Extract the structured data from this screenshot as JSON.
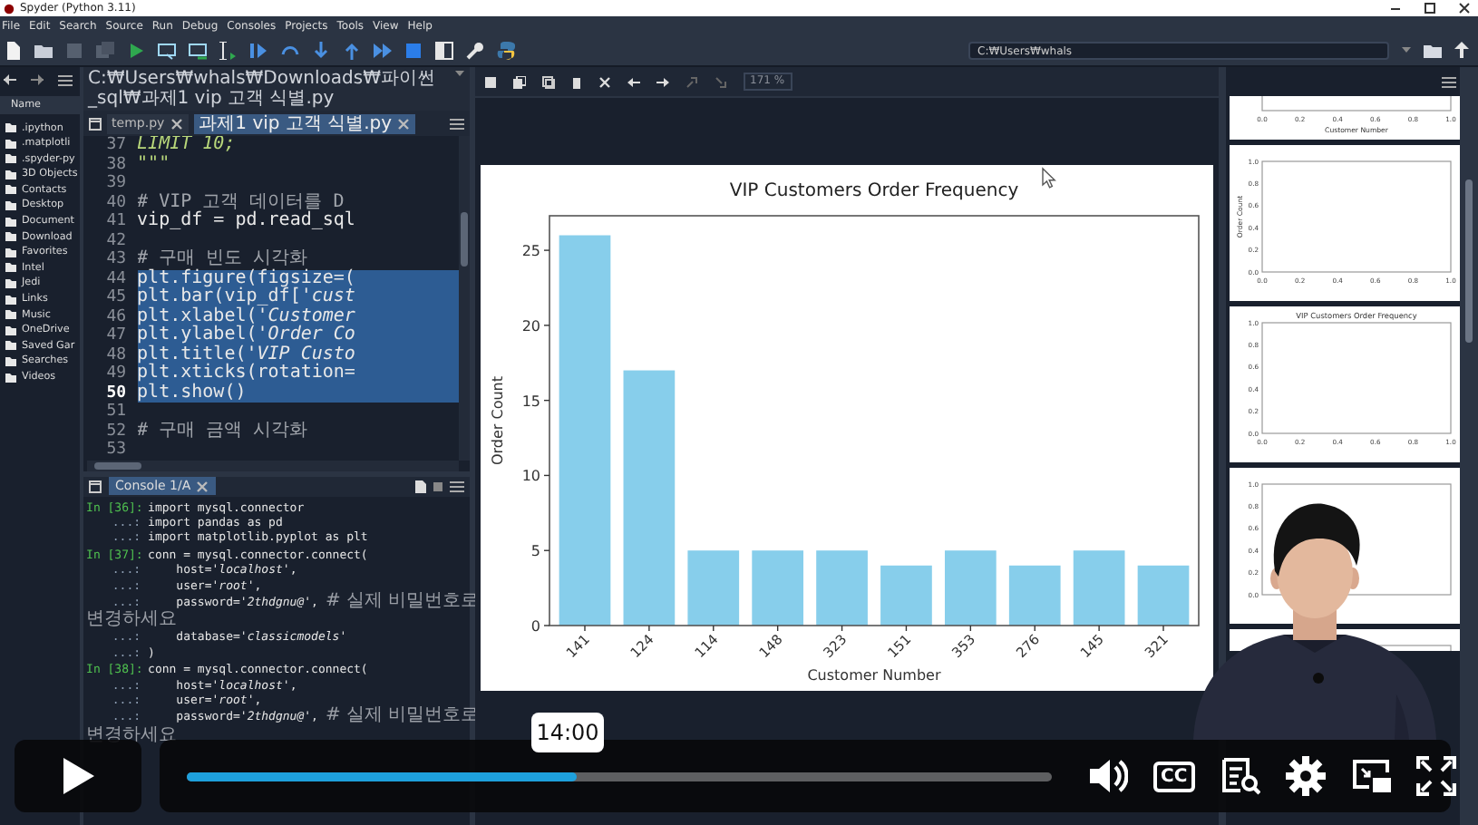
{
  "window": {
    "title": "Spyder (Python 3.11)"
  },
  "menu": [
    "File",
    "Edit",
    "Search",
    "Source",
    "Run",
    "Debug",
    "Consoles",
    "Projects",
    "Tools",
    "View",
    "Help"
  ],
  "toolbar": {
    "path": "C:₩Users₩whals"
  },
  "files": {
    "header": "Name",
    "items": [
      ".ipython",
      ".matplotli",
      ".spyder-py",
      "3D Objects",
      "Contacts",
      "Desktop",
      "Document",
      "Download",
      "Favorites",
      "Intel",
      "Jedi",
      "Links",
      "Music",
      "OneDrive",
      "Saved Gar",
      "Searches",
      "Videos"
    ]
  },
  "editor": {
    "path": "C:₩Users₩whals₩Downloads₩파이썬_sql₩과제1 vip 고객 식별.py",
    "tabs": [
      {
        "label": "temp.py",
        "selected": false
      },
      {
        "label": "과제1 vip 고객 식별.py",
        "selected": true
      }
    ],
    "lines": [
      {
        "number": "37",
        "kind": "string",
        "code": "LIMIT 10;",
        "selected": false,
        "current": false
      },
      {
        "number": "38",
        "kind": "string",
        "code": "\"\"\"",
        "selected": false,
        "current": false
      },
      {
        "number": "39",
        "kind": "code",
        "selected": false,
        "current": false
      },
      {
        "number": "40",
        "kind": "comment",
        "code": "# VIP 고객 데이터를 D",
        "selected": false,
        "current": false
      },
      {
        "number": "41",
        "kind": "code",
        "code": "vip_df = pd.read_sql",
        "selected": false,
        "current": false
      },
      {
        "number": "42",
        "kind": "code",
        "selected": false,
        "current": false
      },
      {
        "number": "43",
        "kind": "comment",
        "code": "# 구매 빈도 시각화",
        "selected": false,
        "current": false
      },
      {
        "number": "44",
        "kind": "code",
        "code": "plt.figure(figsize=(",
        "selected": true,
        "current": false
      },
      {
        "number": "45",
        "kind": "code",
        "code": "plt.bar(vip_df[*'cust*",
        "selected": true,
        "current": false
      },
      {
        "number": "46",
        "kind": "code",
        "code": "plt.xlabel(*'Customer*",
        "selected": true,
        "current": false
      },
      {
        "number": "47",
        "kind": "code",
        "code": "plt.ylabel(*'Order Co*",
        "selected": true,
        "current": false
      },
      {
        "number": "48",
        "kind": "code",
        "code": "plt.title(*'VIP Custo*",
        "selected": true,
        "current": false
      },
      {
        "number": "49",
        "kind": "code",
        "code": "plt.xticks(rotation=",
        "selected": true,
        "current": false
      },
      {
        "number": "50",
        "kind": "code",
        "code": "plt.show()",
        "selected": true,
        "current": true
      },
      {
        "number": "51",
        "kind": "code",
        "selected": false,
        "current": false
      },
      {
        "number": "52",
        "kind": "comment",
        "code": "# 구매 금액 시각화",
        "selected": false,
        "current": false
      },
      {
        "number": "53",
        "kind": "code",
        "selected": false,
        "current": false
      }
    ]
  },
  "console": {
    "title": "Console 1/A",
    "lines": [
      {
        "kind": "input",
        "prompt": "In [36]:",
        "code": "import mysql.connector"
      },
      {
        "kind": "continuation",
        "prompt": "...:",
        "code": "import pandas as pd"
      },
      {
        "kind": "continuation",
        "prompt": "...:",
        "code": "import matplotlib.pyplot as plt"
      },
      {
        "kind": "input",
        "prompt": "In [37]:",
        "code": "conn = mysql.connector.connect("
      },
      {
        "kind": "continuation",
        "prompt": "...:",
        "code": "    host=*'localhost'*,"
      },
      {
        "kind": "continuation",
        "prompt": "...:",
        "code": "    user=*'root'*,"
      },
      {
        "kind": "continuation",
        "prompt": "...:",
        "code": "    password=*'2thdgnu@'*,",
        "comment": "# 실제 비밀번호로"
      },
      {
        "kind": "wrap",
        "comment": "변경하세요"
      },
      {
        "kind": "continuation",
        "prompt": "...:",
        "code": "    database=*'classicmodels'*"
      },
      {
        "kind": "continuation",
        "prompt": "...:",
        "code": ")"
      },
      {
        "kind": "input",
        "prompt": "In [38]:",
        "code": "conn = mysql.connector.connect("
      },
      {
        "kind": "continuation",
        "prompt": "...:",
        "code": "    host=*'localhost'*,"
      },
      {
        "kind": "continuation",
        "prompt": "...:",
        "code": "    user=*'root'*,"
      },
      {
        "kind": "continuation",
        "prompt": "...:",
        "code": "    password=*'2thdgnu@'*,",
        "comment": "# 실제 비밀번호로"
      },
      {
        "kind": "wrap",
        "comment": "변경하세요"
      }
    ]
  },
  "plot": {
    "zoom": "171 %",
    "chart_data": {
      "type": "bar",
      "title": "VIP Customers Order Frequency",
      "xlabel": "Customer Number",
      "ylabel": "Order Count",
      "categories": [
        "141",
        "124",
        "114",
        "148",
        "323",
        "151",
        "353",
        "276",
        "145",
        "321"
      ],
      "series": [
        {
          "color": "#87ceeb",
          "values": [
            26,
            17,
            5,
            5,
            5,
            4,
            5,
            4,
            5,
            4
          ]
        }
      ],
      "ylim": [
        0,
        27.3
      ],
      "yticks": [
        0,
        5,
        10,
        15,
        20,
        25
      ]
    }
  },
  "thumbnails": [
    {
      "kind": "partial",
      "xticks": [
        "0.0",
        "0.2",
        "0.4",
        "0.6",
        "0.8",
        "1.0"
      ],
      "xlabel": "Customer Number"
    },
    {
      "kind": "empty",
      "ylabel": "Order Count",
      "yticks": [
        "1.0",
        "0.8",
        "0.6",
        "0.4",
        "0.2",
        "0.0"
      ],
      "xticks": [
        "0.0",
        "0.2",
        "0.4",
        "0.6",
        "0.8",
        "1.0"
      ]
    },
    {
      "kind": "empty",
      "title": "VIP Customers Order Frequency",
      "yticks": [
        "1.0",
        "0.8",
        "0.6",
        "0.4",
        "0.2",
        "0.0"
      ],
      "xticks": [
        "0.0",
        "0.2",
        "0.4",
        "0.6",
        "0.8",
        "1.0"
      ]
    },
    {
      "kind": "empty",
      "yticks": [
        "1.0",
        "0.8",
        "0.6",
        "0.4",
        "0.2",
        "0.0"
      ]
    },
    {
      "kind": "sliver"
    }
  ],
  "video": {
    "tooltip": "14:00",
    "progress": {
      "level": 0.45
    },
    "captions_label": "CC"
  }
}
